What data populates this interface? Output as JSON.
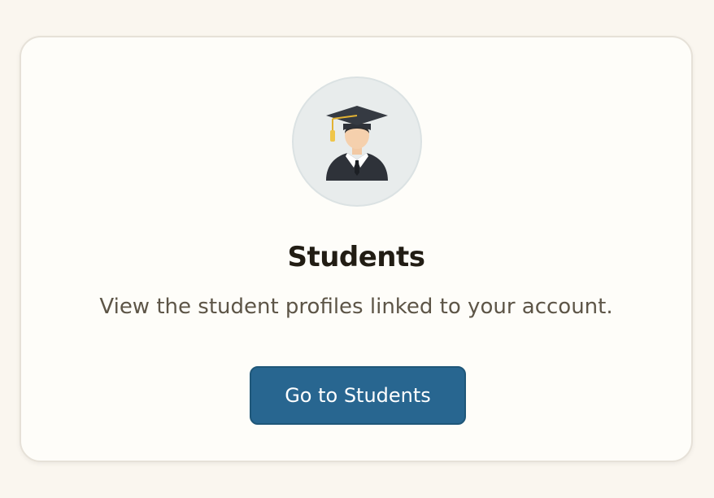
{
  "card": {
    "icon": "graduate-icon",
    "title": "Students",
    "description": "View the student profiles linked to your account.",
    "button_label": "Go to Students"
  },
  "colors": {
    "page_background": "#faf6ef",
    "card_background": "#fefdf9",
    "button": "#286690",
    "title_text": "#221d14",
    "body_text": "#5d5547"
  }
}
